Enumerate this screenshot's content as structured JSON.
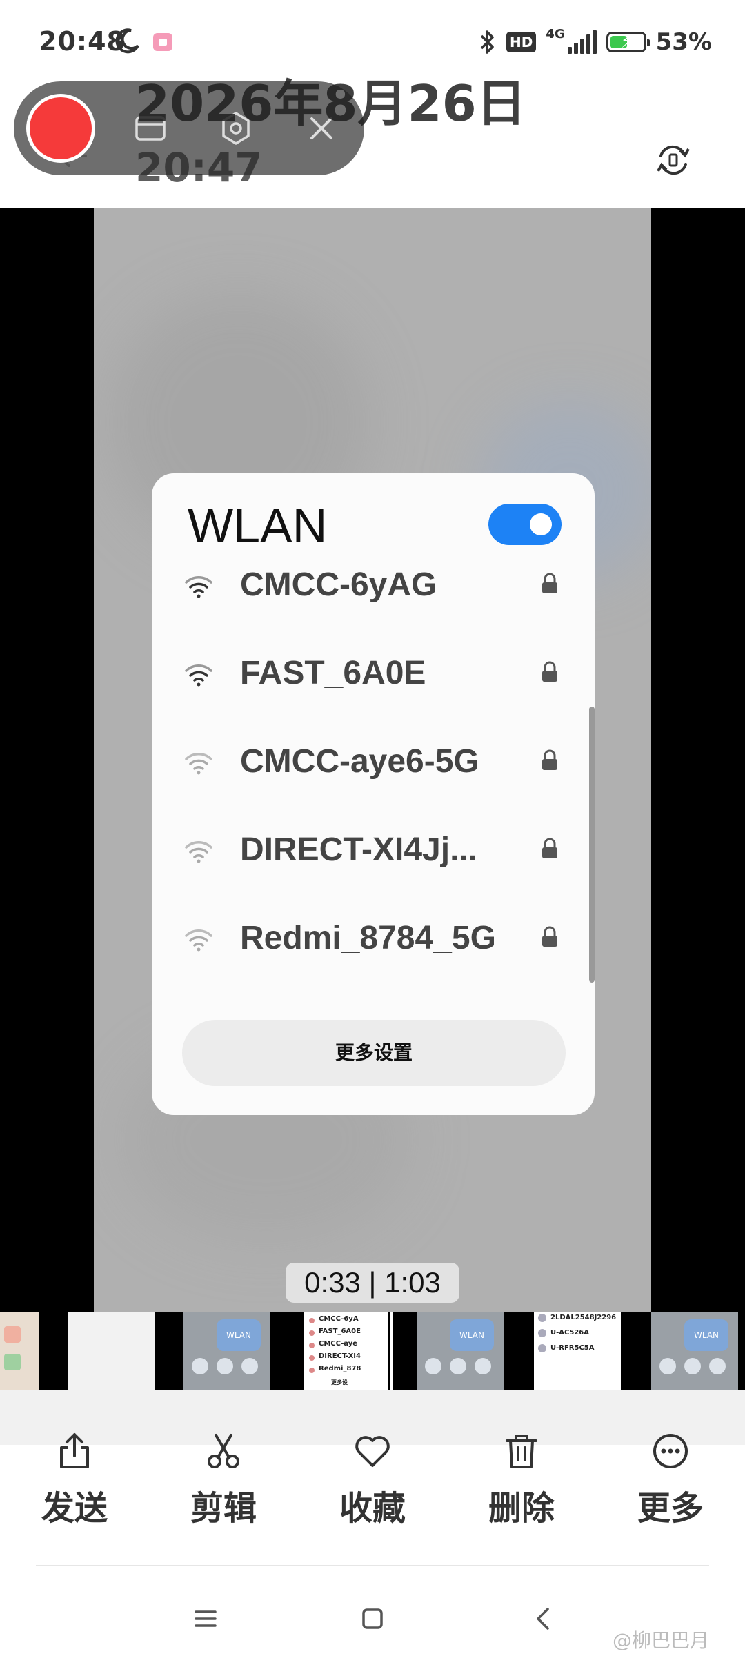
{
  "status_bar": {
    "time": "20:48",
    "hd": "HD",
    "network": "4G",
    "battery_pct_text": "53%",
    "battery_level": 0.53,
    "icons": [
      "moon-icon",
      "screen-record-icon",
      "bluetooth-icon",
      "signal-icon",
      "battery-charging-icon"
    ]
  },
  "recorder": {
    "date": "2026年8月26日",
    "time": "20:47",
    "icons": [
      "record-button",
      "folder-icon",
      "settings-icon",
      "close-icon"
    ]
  },
  "video": {
    "wlan_card": {
      "title": "WLAN",
      "toggle_on": true,
      "networks": [
        {
          "name": "CMCC-6yAG"
        },
        {
          "name": "FAST_6A0E"
        },
        {
          "name": "CMCC-aye6-5G"
        },
        {
          "name": "DIRECT-XI4Jj..."
        },
        {
          "name": "Redmi_8784_5G"
        }
      ],
      "more_settings": "更多设置"
    },
    "time_chip": "0:33 | 1:03",
    "accent_color": "#1d82f5"
  },
  "thumbnails": {
    "mini_wlan": "WLAN",
    "mini_nets": [
      "CMCC-6yA",
      "FAST_6A0E",
      "CMCC-aye",
      "DIRECT-XI4",
      "Redmi_878"
    ],
    "mini_more": "更多设",
    "mini_ids": [
      "2LDAL2548J2296",
      "U-AC526A",
      "U-RFR5C5A"
    ]
  },
  "actions": [
    {
      "label": "发送",
      "icon": "share-icon"
    },
    {
      "label": "剪辑",
      "icon": "scissors-icon"
    },
    {
      "label": "收藏",
      "icon": "heart-icon"
    },
    {
      "label": "删除",
      "icon": "trash-icon"
    },
    {
      "label": "更多",
      "icon": "more-icon"
    }
  ],
  "nav": {
    "icons": [
      "menu-icon",
      "home-icon",
      "back-icon"
    ]
  },
  "watermark": "@柳巴巴月"
}
